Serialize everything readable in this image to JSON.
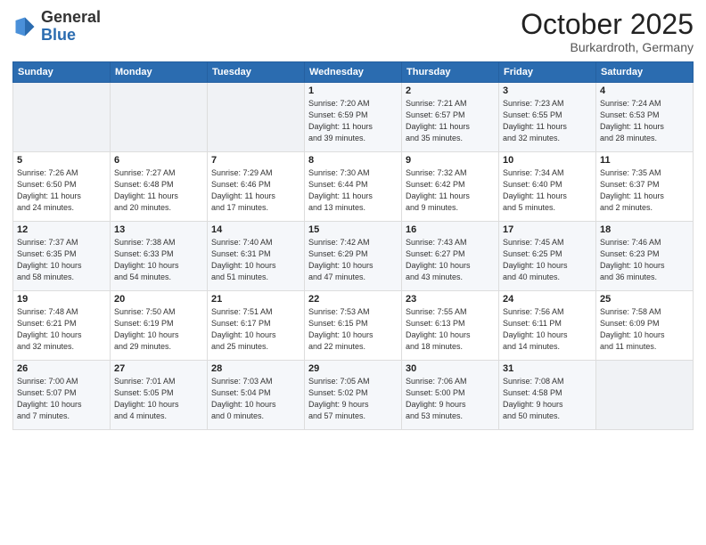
{
  "header": {
    "logo_general": "General",
    "logo_blue": "Blue",
    "month": "October 2025",
    "location": "Burkardroth, Germany"
  },
  "weekdays": [
    "Sunday",
    "Monday",
    "Tuesday",
    "Wednesday",
    "Thursday",
    "Friday",
    "Saturday"
  ],
  "weeks": [
    [
      {
        "day": "",
        "info": ""
      },
      {
        "day": "",
        "info": ""
      },
      {
        "day": "",
        "info": ""
      },
      {
        "day": "1",
        "info": "Sunrise: 7:20 AM\nSunset: 6:59 PM\nDaylight: 11 hours\nand 39 minutes."
      },
      {
        "day": "2",
        "info": "Sunrise: 7:21 AM\nSunset: 6:57 PM\nDaylight: 11 hours\nand 35 minutes."
      },
      {
        "day": "3",
        "info": "Sunrise: 7:23 AM\nSunset: 6:55 PM\nDaylight: 11 hours\nand 32 minutes."
      },
      {
        "day": "4",
        "info": "Sunrise: 7:24 AM\nSunset: 6:53 PM\nDaylight: 11 hours\nand 28 minutes."
      }
    ],
    [
      {
        "day": "5",
        "info": "Sunrise: 7:26 AM\nSunset: 6:50 PM\nDaylight: 11 hours\nand 24 minutes."
      },
      {
        "day": "6",
        "info": "Sunrise: 7:27 AM\nSunset: 6:48 PM\nDaylight: 11 hours\nand 20 minutes."
      },
      {
        "day": "7",
        "info": "Sunrise: 7:29 AM\nSunset: 6:46 PM\nDaylight: 11 hours\nand 17 minutes."
      },
      {
        "day": "8",
        "info": "Sunrise: 7:30 AM\nSunset: 6:44 PM\nDaylight: 11 hours\nand 13 minutes."
      },
      {
        "day": "9",
        "info": "Sunrise: 7:32 AM\nSunset: 6:42 PM\nDaylight: 11 hours\nand 9 minutes."
      },
      {
        "day": "10",
        "info": "Sunrise: 7:34 AM\nSunset: 6:40 PM\nDaylight: 11 hours\nand 5 minutes."
      },
      {
        "day": "11",
        "info": "Sunrise: 7:35 AM\nSunset: 6:37 PM\nDaylight: 11 hours\nand 2 minutes."
      }
    ],
    [
      {
        "day": "12",
        "info": "Sunrise: 7:37 AM\nSunset: 6:35 PM\nDaylight: 10 hours\nand 58 minutes."
      },
      {
        "day": "13",
        "info": "Sunrise: 7:38 AM\nSunset: 6:33 PM\nDaylight: 10 hours\nand 54 minutes."
      },
      {
        "day": "14",
        "info": "Sunrise: 7:40 AM\nSunset: 6:31 PM\nDaylight: 10 hours\nand 51 minutes."
      },
      {
        "day": "15",
        "info": "Sunrise: 7:42 AM\nSunset: 6:29 PM\nDaylight: 10 hours\nand 47 minutes."
      },
      {
        "day": "16",
        "info": "Sunrise: 7:43 AM\nSunset: 6:27 PM\nDaylight: 10 hours\nand 43 minutes."
      },
      {
        "day": "17",
        "info": "Sunrise: 7:45 AM\nSunset: 6:25 PM\nDaylight: 10 hours\nand 40 minutes."
      },
      {
        "day": "18",
        "info": "Sunrise: 7:46 AM\nSunset: 6:23 PM\nDaylight: 10 hours\nand 36 minutes."
      }
    ],
    [
      {
        "day": "19",
        "info": "Sunrise: 7:48 AM\nSunset: 6:21 PM\nDaylight: 10 hours\nand 32 minutes."
      },
      {
        "day": "20",
        "info": "Sunrise: 7:50 AM\nSunset: 6:19 PM\nDaylight: 10 hours\nand 29 minutes."
      },
      {
        "day": "21",
        "info": "Sunrise: 7:51 AM\nSunset: 6:17 PM\nDaylight: 10 hours\nand 25 minutes."
      },
      {
        "day": "22",
        "info": "Sunrise: 7:53 AM\nSunset: 6:15 PM\nDaylight: 10 hours\nand 22 minutes."
      },
      {
        "day": "23",
        "info": "Sunrise: 7:55 AM\nSunset: 6:13 PM\nDaylight: 10 hours\nand 18 minutes."
      },
      {
        "day": "24",
        "info": "Sunrise: 7:56 AM\nSunset: 6:11 PM\nDaylight: 10 hours\nand 14 minutes."
      },
      {
        "day": "25",
        "info": "Sunrise: 7:58 AM\nSunset: 6:09 PM\nDaylight: 10 hours\nand 11 minutes."
      }
    ],
    [
      {
        "day": "26",
        "info": "Sunrise: 7:00 AM\nSunset: 5:07 PM\nDaylight: 10 hours\nand 7 minutes."
      },
      {
        "day": "27",
        "info": "Sunrise: 7:01 AM\nSunset: 5:05 PM\nDaylight: 10 hours\nand 4 minutes."
      },
      {
        "day": "28",
        "info": "Sunrise: 7:03 AM\nSunset: 5:04 PM\nDaylight: 10 hours\nand 0 minutes."
      },
      {
        "day": "29",
        "info": "Sunrise: 7:05 AM\nSunset: 5:02 PM\nDaylight: 9 hours\nand 57 minutes."
      },
      {
        "day": "30",
        "info": "Sunrise: 7:06 AM\nSunset: 5:00 PM\nDaylight: 9 hours\nand 53 minutes."
      },
      {
        "day": "31",
        "info": "Sunrise: 7:08 AM\nSunset: 4:58 PM\nDaylight: 9 hours\nand 50 minutes."
      },
      {
        "day": "",
        "info": ""
      }
    ]
  ]
}
